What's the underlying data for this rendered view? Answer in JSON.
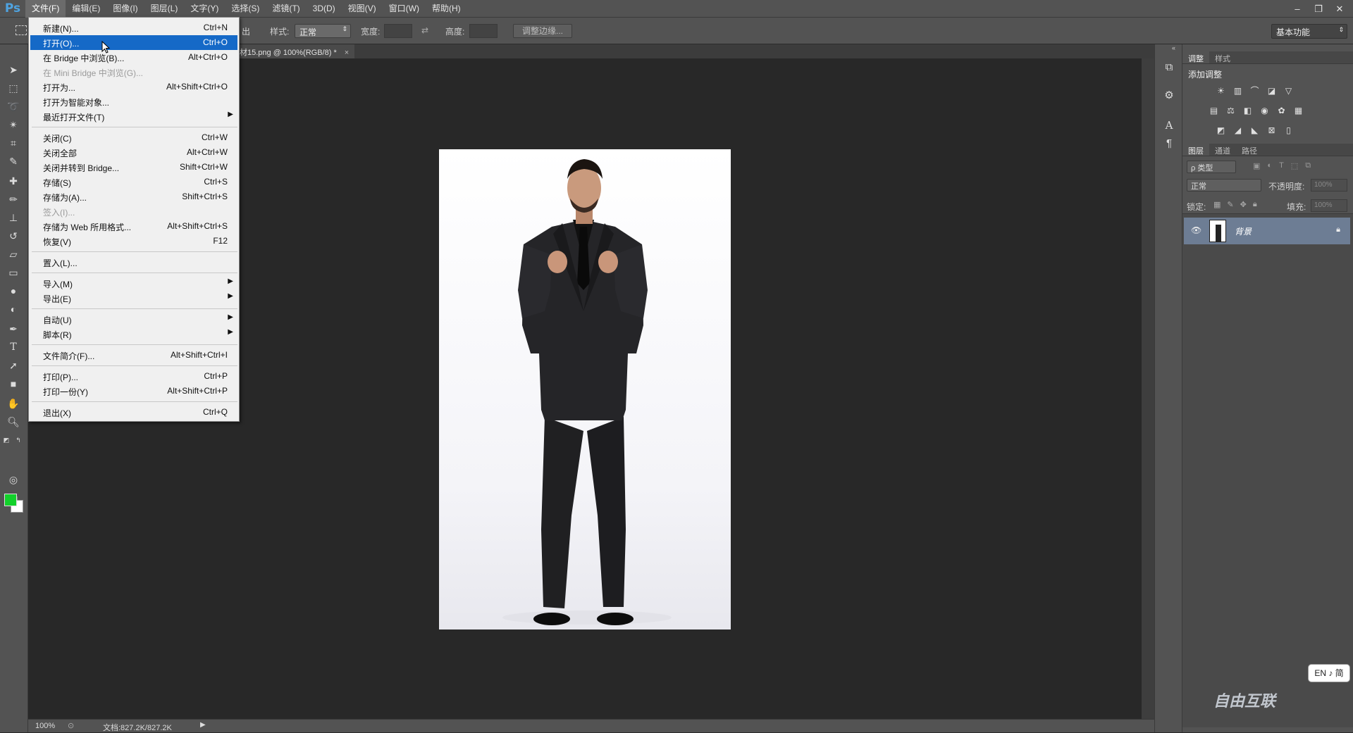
{
  "app": {
    "logo": "Ps"
  },
  "menubar": {
    "items": [
      "文件(F)",
      "编辑(E)",
      "图像(I)",
      "图层(L)",
      "文字(Y)",
      "选择(S)",
      "滤镜(T)",
      "3D(D)",
      "视图(V)",
      "窗口(W)",
      "帮助(H)"
    ],
    "active_index": 0,
    "window_controls": [
      "–",
      "❐",
      "✕"
    ]
  },
  "options": {
    "partial_label": "出",
    "style_label": "样式:",
    "style_value": "正常",
    "width_label": "宽度:",
    "height_label": "高度:",
    "refine_edge": "调整边缘...",
    "workspace": "基本功能"
  },
  "document": {
    "tab_title": "材15.png @ 100%(RGB/8) *",
    "tab_close": "×"
  },
  "status": {
    "zoom": "100%",
    "doc_info": "文档:827.2K/827.2K"
  },
  "file_menu": {
    "items": [
      {
        "label": "新建(N)...",
        "shortcut": "Ctrl+N"
      },
      {
        "label": "打开(O)...",
        "shortcut": "Ctrl+O",
        "highlighted": true
      },
      {
        "label": "在 Bridge 中浏览(B)...",
        "shortcut": "Alt+Ctrl+O"
      },
      {
        "label": "在 Mini Bridge 中浏览(G)...",
        "shortcut": "",
        "disabled": true
      },
      {
        "label": "打开为...",
        "shortcut": "Alt+Shift+Ctrl+O"
      },
      {
        "label": "打开为智能对象...",
        "shortcut": ""
      },
      {
        "label": "最近打开文件(T)",
        "shortcut": "",
        "submenu": true
      },
      {
        "label": "关闭(C)",
        "shortcut": "Ctrl+W"
      },
      {
        "label": "关闭全部",
        "shortcut": "Alt+Ctrl+W"
      },
      {
        "label": "关闭并转到 Bridge...",
        "shortcut": "Shift+Ctrl+W"
      },
      {
        "label": "存储(S)",
        "shortcut": "Ctrl+S"
      },
      {
        "label": "存储为(A)...",
        "shortcut": "Shift+Ctrl+S"
      },
      {
        "label": "签入(I)...",
        "shortcut": "",
        "disabled": true
      },
      {
        "label": "存储为 Web 所用格式...",
        "shortcut": "Alt+Shift+Ctrl+S"
      },
      {
        "label": "恢复(V)",
        "shortcut": "F12"
      },
      {
        "label": "置入(L)...",
        "shortcut": ""
      },
      {
        "label": "导入(M)",
        "shortcut": "",
        "submenu": true
      },
      {
        "label": "导出(E)",
        "shortcut": "",
        "submenu": true
      },
      {
        "label": "自动(U)",
        "shortcut": "",
        "submenu": true
      },
      {
        "label": "脚本(R)",
        "shortcut": "",
        "submenu": true
      },
      {
        "label": "文件简介(F)...",
        "shortcut": "Alt+Shift+Ctrl+I"
      },
      {
        "label": "打印(P)...",
        "shortcut": "Ctrl+P"
      },
      {
        "label": "打印一份(Y)",
        "shortcut": "Alt+Shift+Ctrl+P"
      },
      {
        "label": "退出(X)",
        "shortcut": "Ctrl+Q"
      }
    ]
  },
  "panels": {
    "adjust_tabs": [
      "调整",
      "样式"
    ],
    "adjust_title": "添加调整",
    "layers_tabs": [
      "图层",
      "通道",
      "路径"
    ],
    "kind_filter": "ρ 类型",
    "blend_mode": "正常",
    "opacity_label": "不透明度:",
    "opacity_value": "100%",
    "lock_label": "锁定:",
    "fill_label": "填充:",
    "fill_value": "100%",
    "layer_name": "背景"
  },
  "ime": "EN ♪ 简",
  "watermark": "自由互联",
  "colors": {
    "foreground": "#12d12b",
    "background": "#ffffff",
    "menu_highlight": "#1569c7",
    "layer_selected": "#6d7d94"
  }
}
